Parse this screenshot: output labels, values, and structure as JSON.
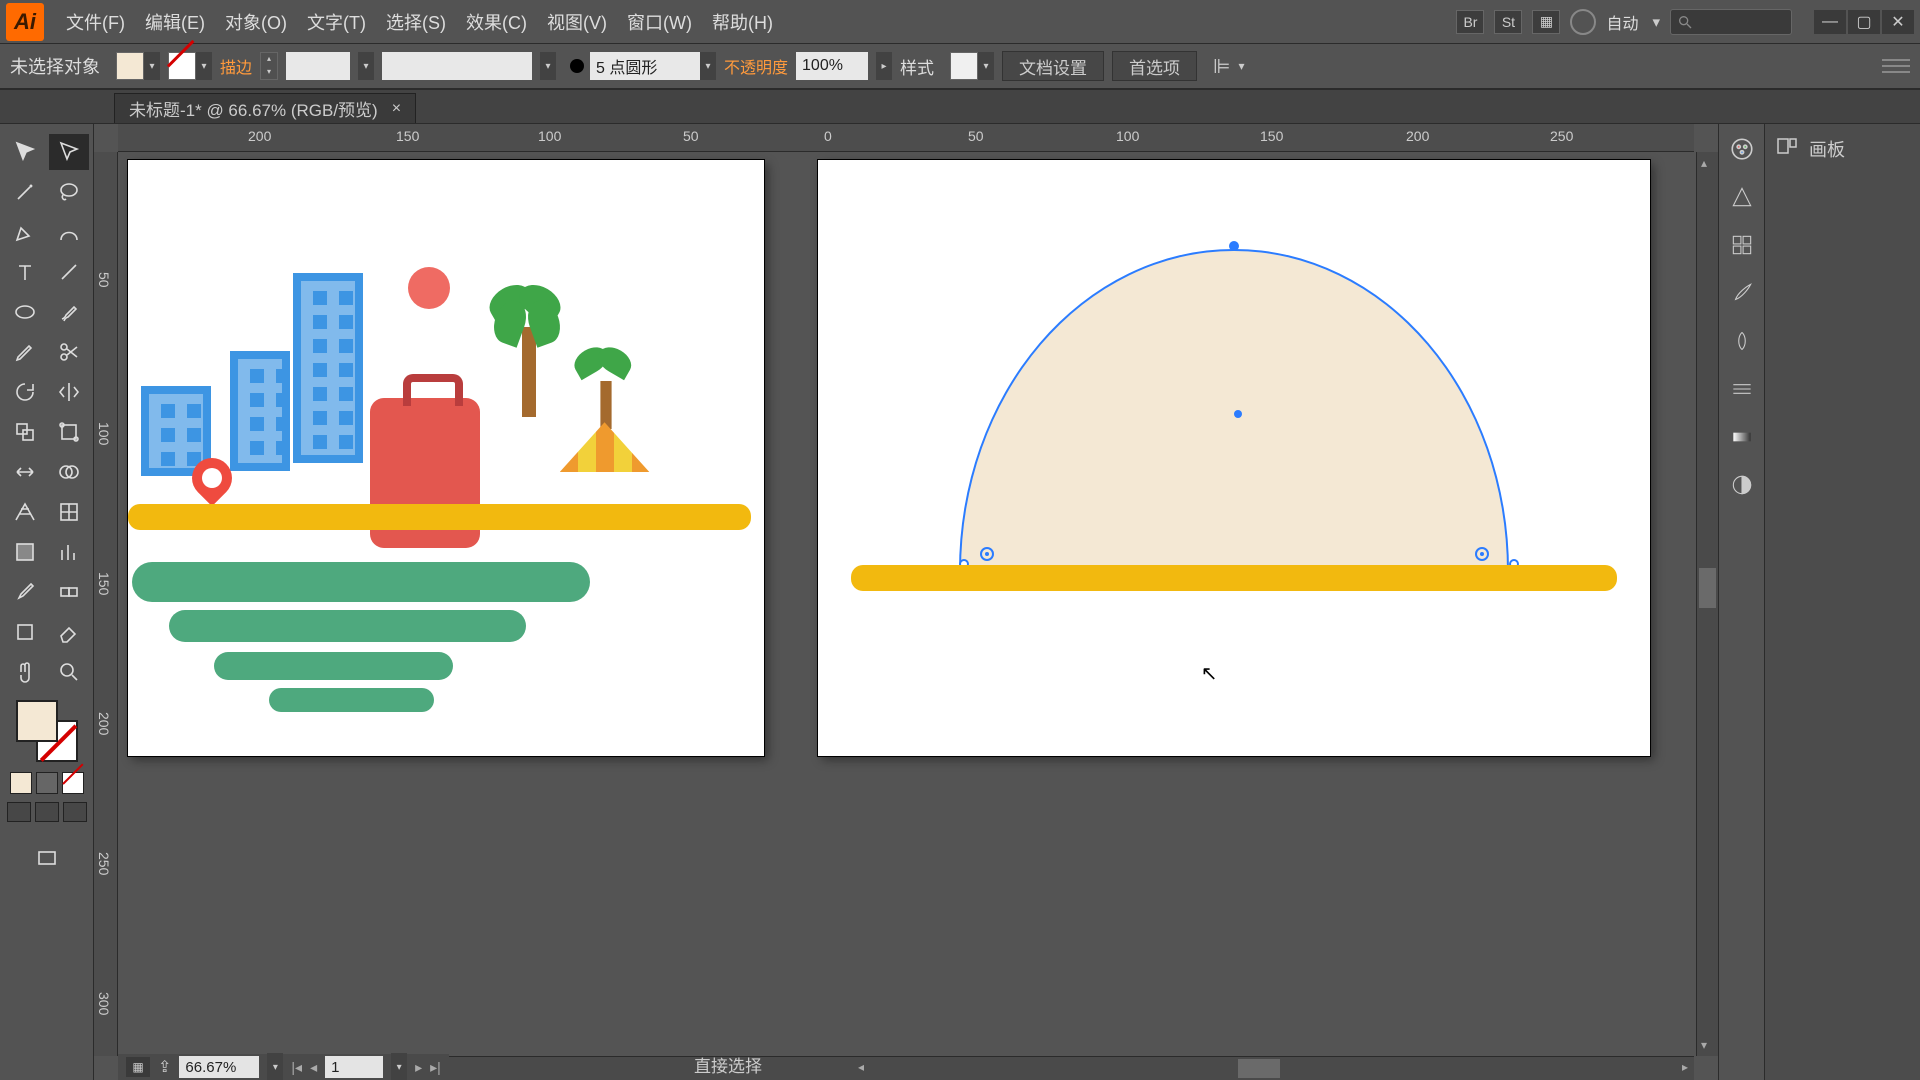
{
  "menubar": {
    "logo": "Ai",
    "items": [
      "文件(F)",
      "编辑(E)",
      "对象(O)",
      "文字(T)",
      "选择(S)",
      "效果(C)",
      "视图(V)",
      "窗口(W)",
      "帮助(H)"
    ],
    "bridge": "Br",
    "stock": "St",
    "auto": "自动"
  },
  "controlbar": {
    "selection": "未选择对象",
    "stroke_label": "描边",
    "stroke_weight": "",
    "stroke_profile": "5 点圆形",
    "opacity_label": "不透明度",
    "opacity": "100%",
    "style_label": "样式",
    "doc_setup": "文档设置",
    "prefs": "首选项",
    "fill_color": "#f4e8d4"
  },
  "doctab": {
    "title": "未标题-1* @ 66.67% (RGB/预览)",
    "close": "×"
  },
  "ruler_h": [
    "200",
    "150",
    "100",
    "50",
    "0",
    "50",
    "100",
    "150",
    "200",
    "250"
  ],
  "ruler_v": [
    "50",
    "100",
    "150",
    "200",
    "250",
    "300"
  ],
  "artboard2": {
    "dome_fill": "#f4e8d4",
    "ground": "#f2b90f"
  },
  "status": {
    "zoom": "66.67%",
    "page": "1",
    "tool": "直接选择"
  },
  "right_panel": {
    "artboard_label": "画板"
  }
}
